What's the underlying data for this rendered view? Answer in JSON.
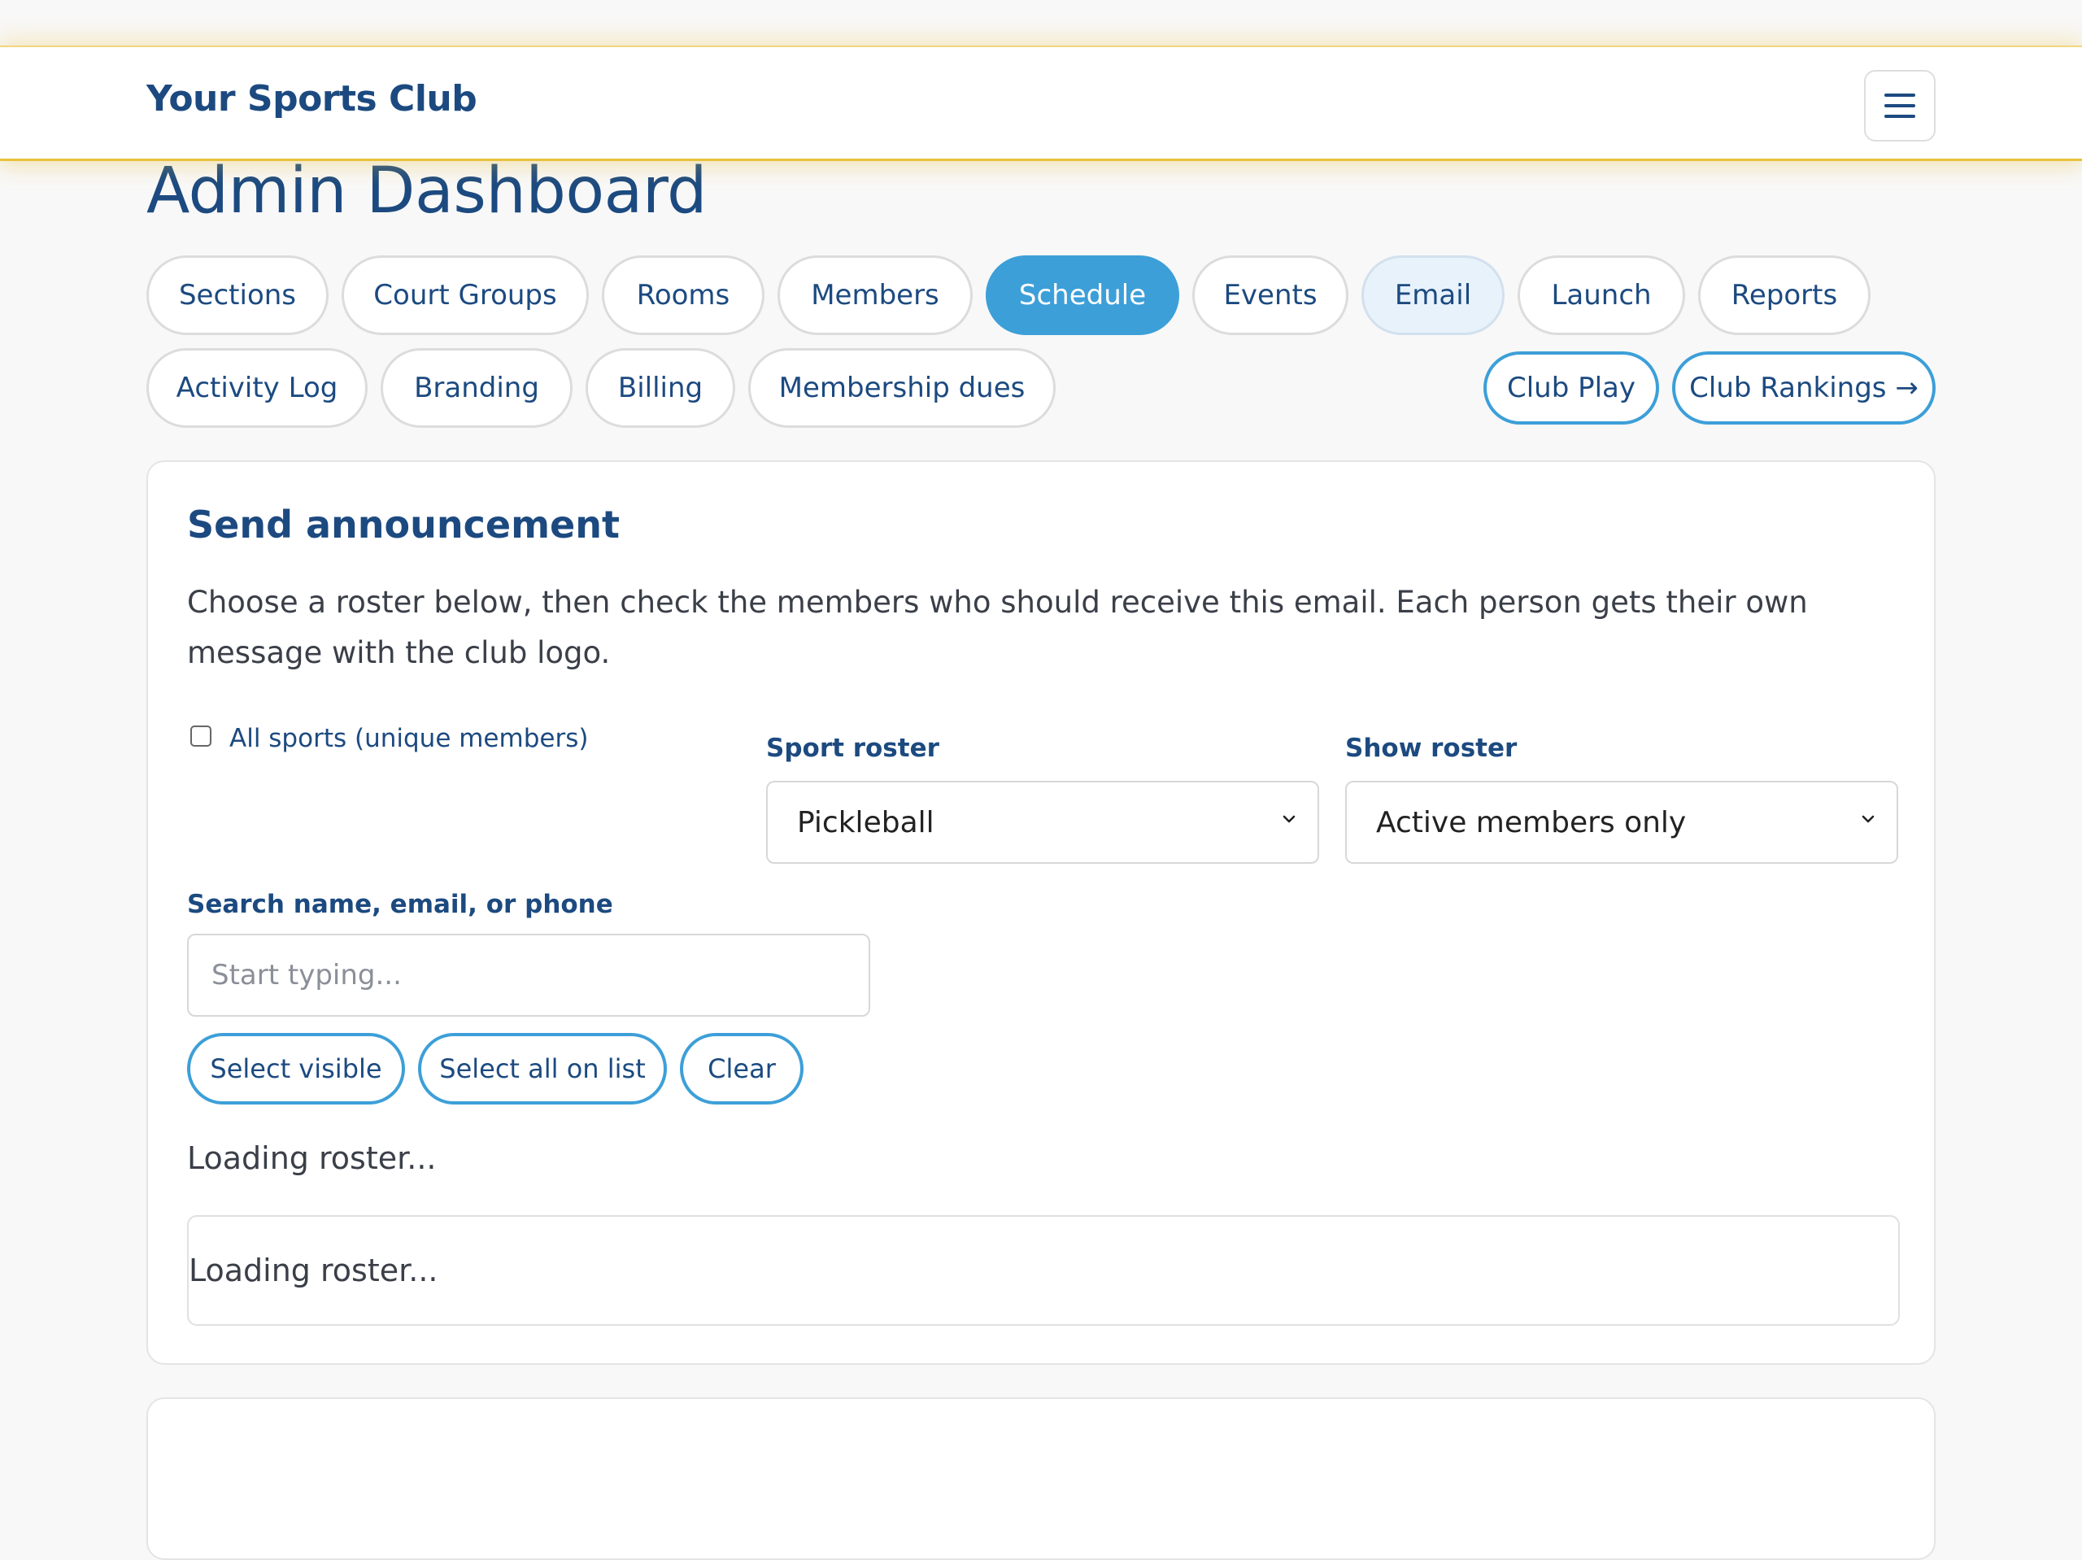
{
  "header": {
    "brand": "Your Sports Club",
    "menu_icon": "hamburger-icon"
  },
  "page": {
    "title": "Admin Dashboard"
  },
  "nav": {
    "row1": [
      "Sections",
      "Court Groups",
      "Rooms",
      "Members",
      "Schedule",
      "Events",
      "Email",
      "Launch",
      "Reports"
    ],
    "row2": [
      "Activity Log",
      "Branding",
      "Billing",
      "Membership dues"
    ],
    "active": "Schedule",
    "highlighted": "Email",
    "club_play": "Club Play",
    "club_rankings": "Club Rankings →"
  },
  "announcement": {
    "title": "Send announcement",
    "description": "Choose a roster below, then check the members who should receive this email. Each person gets their own message with the club logo.",
    "all_sports_label": "All sports (unique members)",
    "all_sports_checked": false,
    "sport_roster_label": "Sport roster",
    "sport_roster_value": "Pickleball",
    "show_roster_label": "Show roster",
    "show_roster_value": "Active members only",
    "search_label": "Search name, email, or phone",
    "search_placeholder": "Start typing...",
    "buttons": {
      "select_visible": "Select visible",
      "select_all": "Select all on list",
      "clear": "Clear"
    },
    "status": "Loading roster...",
    "roster_placeholder": "Loading roster..."
  },
  "colors": {
    "brand": "#1c4a80",
    "accent": "#3d9fd8",
    "header_border": "#e8c23c"
  }
}
